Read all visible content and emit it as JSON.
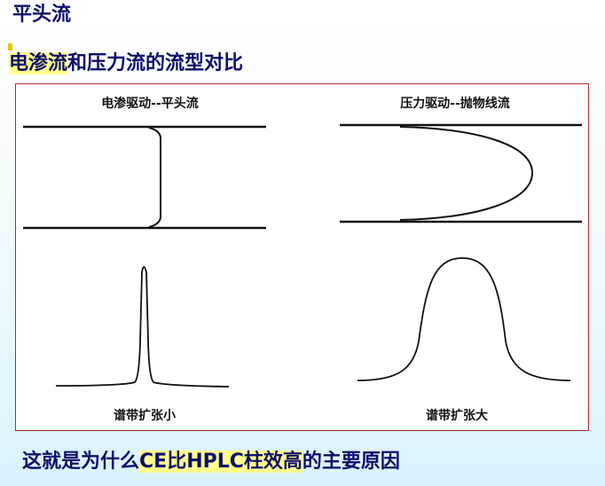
{
  "heading": "平头流",
  "subtitle": {
    "highlighted": "电渗流",
    "rest": "和压力流的流型对比"
  },
  "figure": {
    "left_panel": {
      "title": "电渗驱动--平头流",
      "peak_caption": "谱带扩张小"
    },
    "right_panel": {
      "title": "压力驱动--抛物线流",
      "peak_caption": "谱带扩张大"
    }
  },
  "conclusion": {
    "before": "这就是为什么",
    "highlighted": "CE比HPLC柱效高",
    "after": "的主要原因"
  },
  "colors": {
    "text": "#0d0d6b",
    "highlight": "#ffff8c",
    "frame": "#b02a2a"
  }
}
